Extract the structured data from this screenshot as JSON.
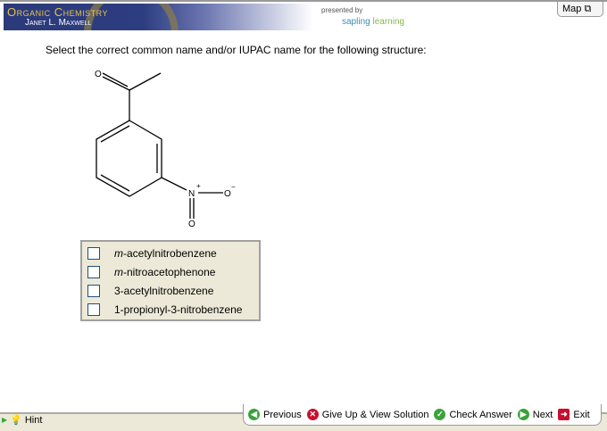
{
  "header": {
    "title": "Organic Chemistry",
    "author": "Janet L. Maxwell",
    "presented_by": "presented by",
    "brand_a": "sapling",
    "brand_b": "learning",
    "map_label": "Map"
  },
  "question": "Select the correct common name and/or IUPAC name for the following structure:",
  "structure": {
    "atoms": {
      "o_carbonyl": "O",
      "n": "N",
      "n_charge": "+",
      "o_minus": "O",
      "o_minus_charge": "−",
      "o_double": "O"
    }
  },
  "choices": [
    {
      "prefix": "m",
      "label": "-acetylnitrobenzene",
      "checked": false
    },
    {
      "prefix": "m",
      "label": "-nitroacetophenone",
      "checked": false
    },
    {
      "prefix": "",
      "label": "3-acetylnitrobenzene",
      "checked": false
    },
    {
      "prefix": "",
      "label": "1-propionyl-3-nitrobenzene",
      "checked": false
    }
  ],
  "footer": {
    "hint": "Hint",
    "previous": "Previous",
    "give_up": "Give Up & View Solution",
    "check": "Check Answer",
    "next": "Next",
    "exit": "Exit"
  },
  "colors": {
    "green": "#3aa33a",
    "red": "#c8102e"
  }
}
